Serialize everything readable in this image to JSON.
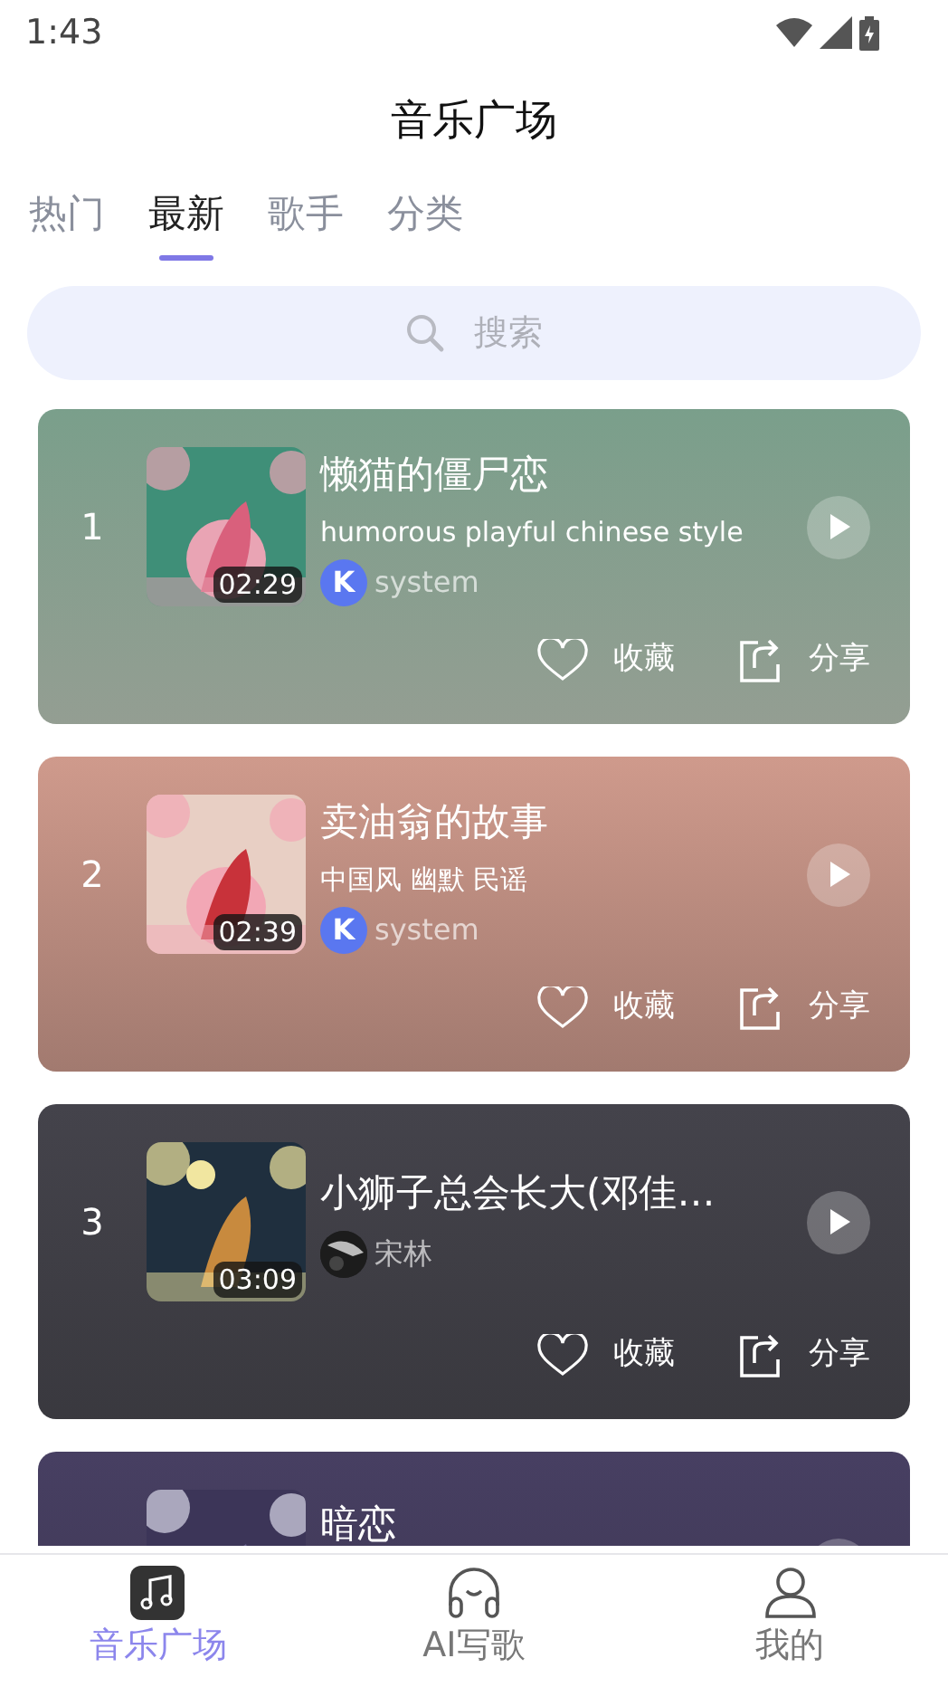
{
  "status_bar": {
    "time": "1:43"
  },
  "header": {
    "title": "音乐广场"
  },
  "tabs": [
    {
      "label": "热门",
      "selected": false
    },
    {
      "label": "最新",
      "selected": true
    },
    {
      "label": "歌手",
      "selected": false
    },
    {
      "label": "分类",
      "selected": false
    }
  ],
  "search": {
    "placeholder": "搜索"
  },
  "songs": [
    {
      "rank": "1",
      "title": "懒猫的僵尸恋",
      "subtitle": "humorous playful chinese style",
      "duration": "02:29",
      "author": "system",
      "avatar": {
        "kind": "logo",
        "label": "K"
      },
      "color": "#7a9f8b",
      "favorite_label": "收藏",
      "share_label": "分享"
    },
    {
      "rank": "2",
      "title": "卖油翁的故事",
      "subtitle": "中国风 幽默 民谣",
      "duration": "02:39",
      "author": "system",
      "avatar": {
        "kind": "logo",
        "label": "K"
      },
      "color": "#cf9a8c",
      "favorite_label": "收藏",
      "share_label": "分享"
    },
    {
      "rank": "3",
      "title": "小狮子总会长大(邓佳…",
      "duration": "03:09",
      "author": "宋林",
      "color": "#44434b",
      "favorite_label": "收藏",
      "share_label": "分享"
    },
    {
      "title": "暗恋",
      "color": "#473f62"
    }
  ],
  "bottom_nav": [
    {
      "label": "音乐广场",
      "kind": "music",
      "selected": true
    },
    {
      "label": "AI写歌",
      "kind": "headphones",
      "selected": false
    },
    {
      "label": "我的",
      "kind": "user",
      "selected": false
    }
  ]
}
